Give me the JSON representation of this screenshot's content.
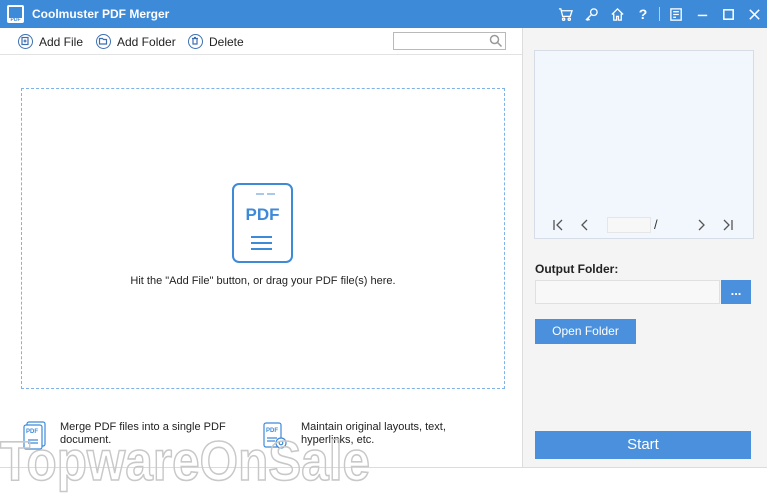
{
  "window": {
    "title": "Coolmuster PDF Merger",
    "logo_text": "PDF",
    "controls": [
      "cart-icon",
      "key-icon",
      "home-icon",
      "help-icon",
      "feedback-icon",
      "minimize-icon",
      "maximize-icon",
      "close-icon"
    ],
    "help_glyph": "?"
  },
  "toolbar": {
    "add_file": "Add File",
    "add_folder": "Add Folder",
    "delete": "Delete",
    "search_placeholder": ""
  },
  "dropzone": {
    "icon_text": "PDF",
    "hint": "Hit the \"Add File\" button, or drag your PDF file(s) here."
  },
  "features": [
    {
      "text": "Merge PDF files into a single PDF document.",
      "icon_text": "PDF"
    },
    {
      "text": "Maintain original layouts, text, hyperlinks, etc.",
      "icon_text": "PDF"
    }
  ],
  "preview": {
    "page_value": "",
    "page_separator": "/"
  },
  "output": {
    "label": "Output Folder:",
    "path": "",
    "browse": "...",
    "open_folder": "Open Folder",
    "start": "Start"
  },
  "watermark": "TopwareOnSale",
  "colors": {
    "titlebar": "#3d8ad8",
    "accent": "#4a90dc",
    "dropzone_border": "#7fb2e8"
  }
}
